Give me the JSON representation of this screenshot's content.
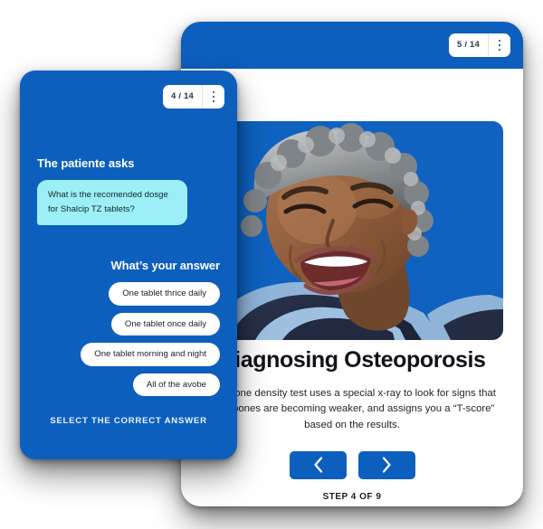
{
  "right_card": {
    "badge": {
      "counter": "5 / 14",
      "menu_icon": "kebab-menu-icon"
    },
    "photo": {
      "alt": "Smiling older woman with curly grey hair laughing, wearing a navy and light-blue striped top, against a blue background",
      "background_color": "#0f62c0"
    },
    "headline": "Diagnosing Osteoporosis",
    "body": "The bone density test uses a special x-ray to look for signs that your bones are becoming weaker, and assigns you a “T-score” based on the results.",
    "nav": {
      "prev_icon": "chevron-left-icon",
      "next_icon": "chevron-right-icon"
    },
    "step_label": "STEP 4 OF 9"
  },
  "left_card": {
    "badge": {
      "counter": "4 / 14",
      "menu_icon": "kebab-menu-icon"
    },
    "ask_title": "The patiente asks",
    "question": "What is the recomended dosge for Shalcip TZ tablets?",
    "answer_title": "What’s your answer",
    "options": [
      "One tablet thrice daily",
      "One tablet once daily",
      "One tablet morning and night",
      "All of the avobe"
    ],
    "select_hint": "SELECT THE CORRECT ANSWER"
  },
  "colors": {
    "brand_blue": "#0d5fbe",
    "photo_blue": "#0f62c0",
    "bubble_cyan": "#9ceff6",
    "card_white": "#ffffff",
    "text_dark": "#111318"
  }
}
